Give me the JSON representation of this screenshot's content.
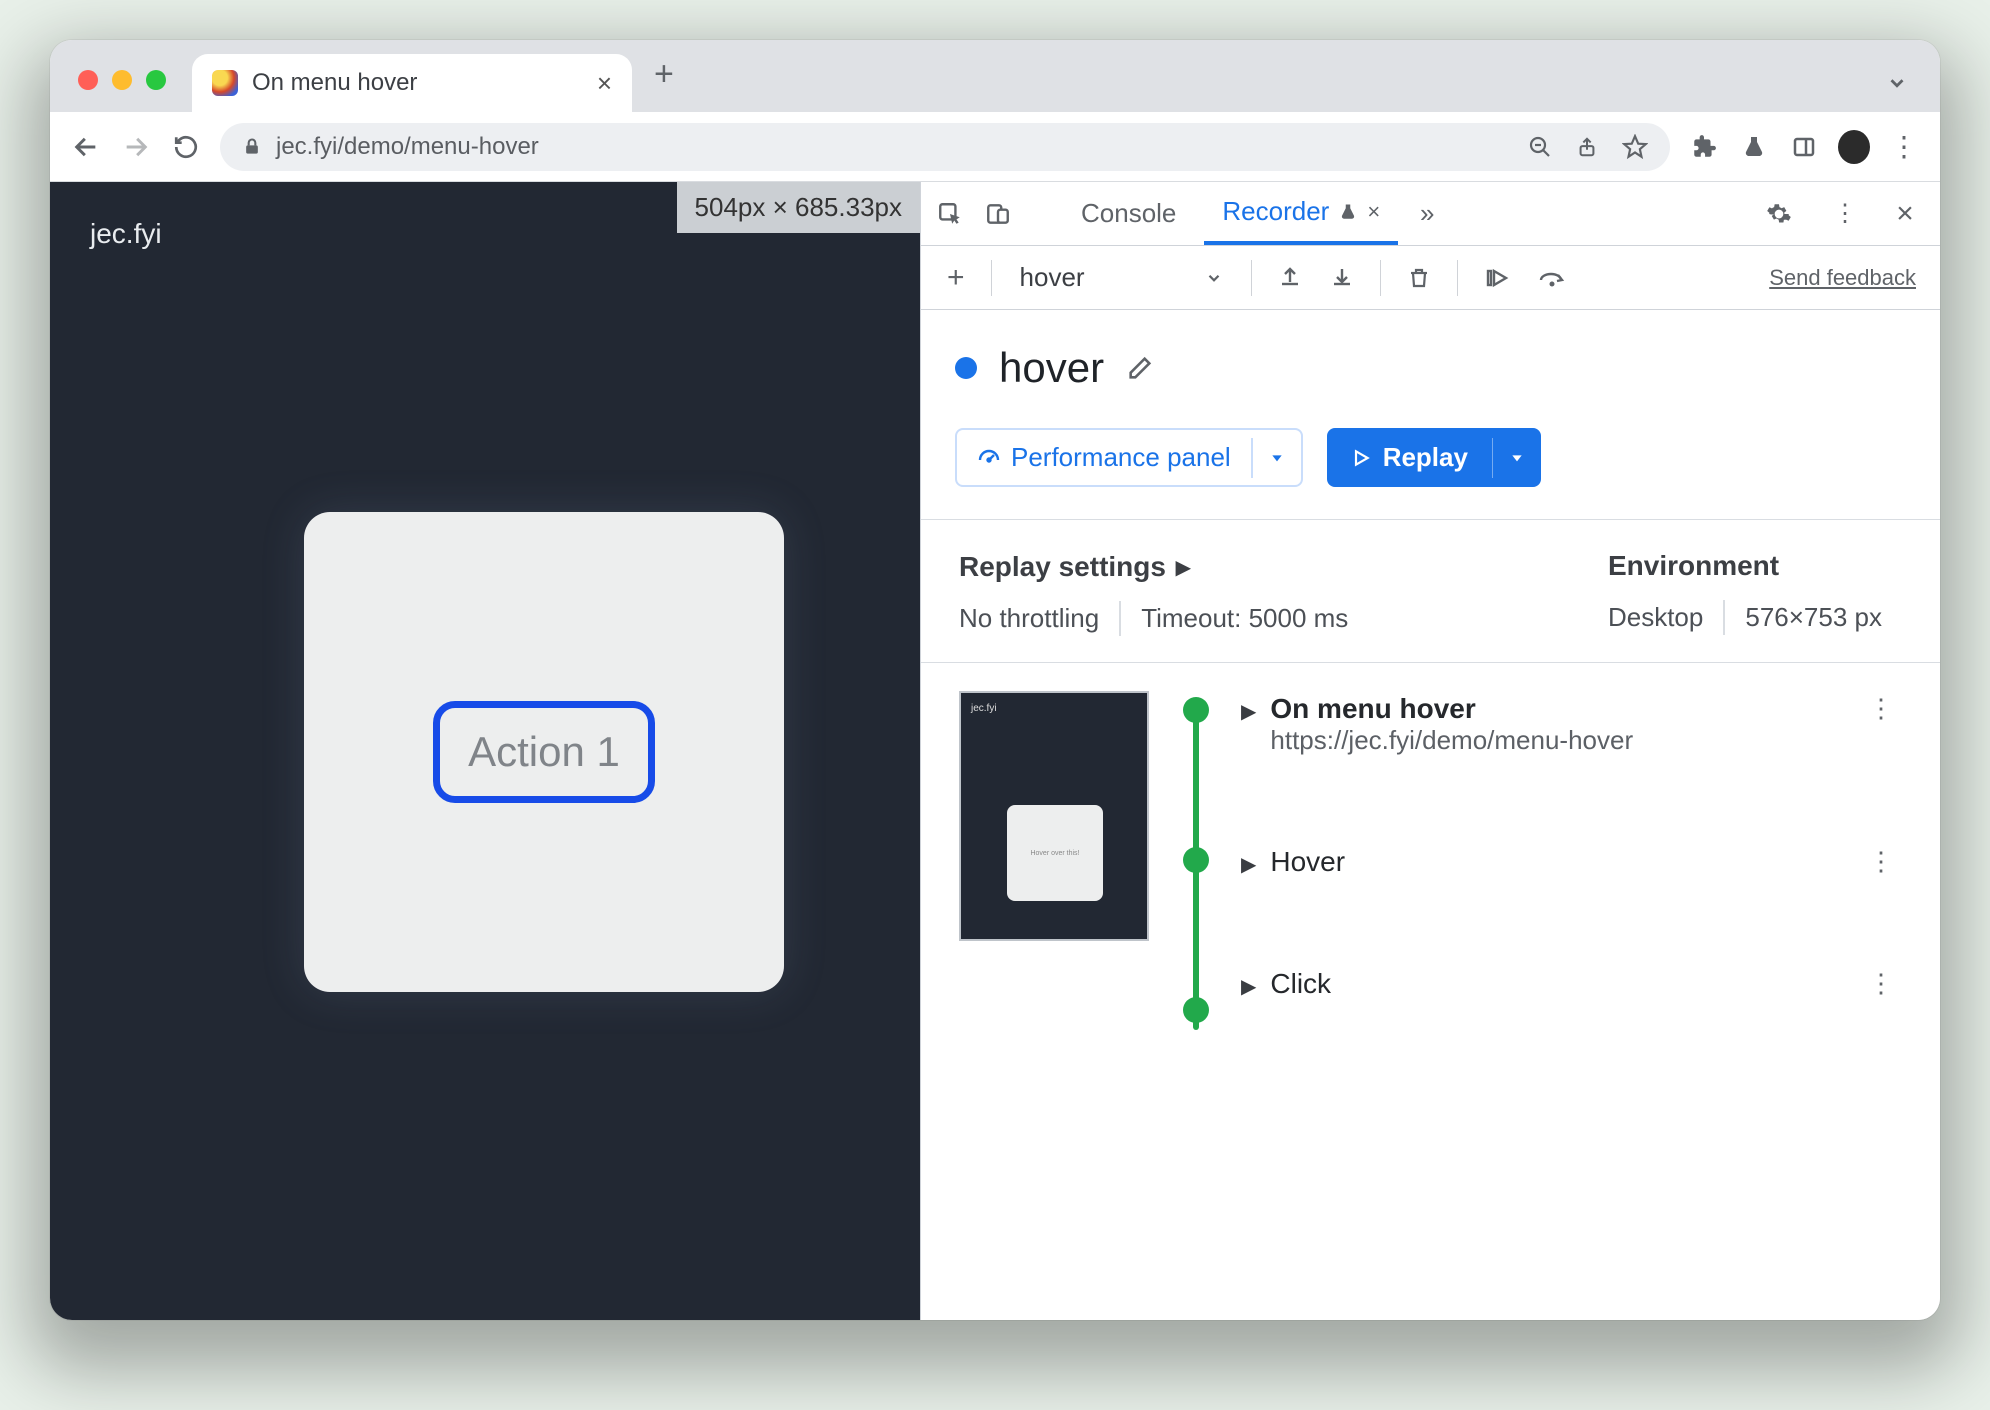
{
  "browser": {
    "tab_title": "On menu hover",
    "url_display": "jec.fyi/demo/menu-hover"
  },
  "page": {
    "site_label": "jec.fyi",
    "dimension_overlay": "504px × 685.33px",
    "action_button": "Action 1"
  },
  "devtools": {
    "tabs": {
      "console": "Console",
      "recorder": "Recorder"
    },
    "toolbar_select": "hover",
    "feedback": "Send feedback",
    "recording_name": "hover",
    "perf_button": "Performance panel",
    "replay_button": "Replay",
    "settings": {
      "replay_heading": "Replay settings",
      "throttling": "No throttling",
      "timeout": "Timeout: 5000 ms",
      "env_heading": "Environment",
      "device": "Desktop",
      "viewport": "576×753 px"
    },
    "steps": [
      {
        "title": "On menu hover",
        "subtitle": "https://jec.fyi/demo/menu-hover"
      },
      {
        "title": "Hover"
      },
      {
        "title": "Click"
      }
    ],
    "thumb_mini": "Hover over this!"
  }
}
